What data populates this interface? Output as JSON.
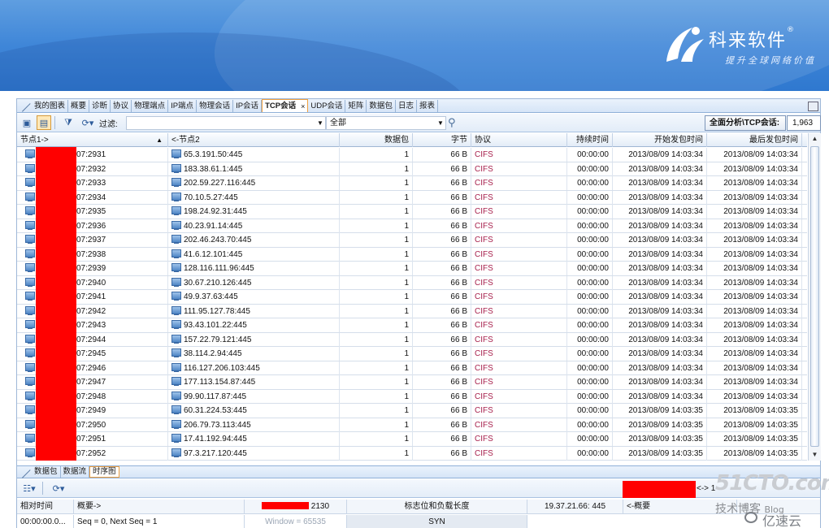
{
  "brand": {
    "name": "科来软件",
    "reg": "®",
    "slogan": "提升全球网络价值"
  },
  "top_tabs": [
    {
      "label": "我的图表",
      "active": false
    },
    {
      "label": "概要",
      "active": false
    },
    {
      "label": "诊断",
      "active": false
    },
    {
      "label": "协议",
      "active": false
    },
    {
      "label": "物理端点",
      "active": false
    },
    {
      "label": "IP端点",
      "active": false
    },
    {
      "label": "物理会话",
      "active": false
    },
    {
      "label": "IP会话",
      "active": false
    },
    {
      "label": "TCP会话",
      "active": true,
      "close": "×"
    },
    {
      "label": "UDP会话",
      "active": false
    },
    {
      "label": "矩阵",
      "active": false
    },
    {
      "label": "数据包",
      "active": false
    },
    {
      "label": "日志",
      "active": false
    },
    {
      "label": "报表",
      "active": false
    }
  ],
  "toolbar": {
    "filter_label": "过滤:",
    "scope_value": "全部",
    "summary_label": "全面分析\\TCP会话:",
    "summary_count": "1,963"
  },
  "table": {
    "columns": [
      "节点1->",
      "<-节点2",
      "数据包",
      "字节",
      "协议",
      "持续时间",
      "开始发包时间",
      "最后发包时间"
    ],
    "rows": [
      {
        "node1": "07:2931",
        "node2": "65.3.191.50:445",
        "packets": "1",
        "bytes": "66 B",
        "protocol": "CIFS",
        "duration": "00:00:00",
        "start": "2013/08/09 14:03:34",
        "last": "2013/08/09 14:03:34"
      },
      {
        "node1": "07:2932",
        "node2": "183.38.61.1:445",
        "packets": "1",
        "bytes": "66 B",
        "protocol": "CIFS",
        "duration": "00:00:00",
        "start": "2013/08/09 14:03:34",
        "last": "2013/08/09 14:03:34"
      },
      {
        "node1": "07:2933",
        "node2": "202.59.227.116:445",
        "packets": "1",
        "bytes": "66 B",
        "protocol": "CIFS",
        "duration": "00:00:00",
        "start": "2013/08/09 14:03:34",
        "last": "2013/08/09 14:03:34"
      },
      {
        "node1": "07:2934",
        "node2": "70.10.5.27:445",
        "packets": "1",
        "bytes": "66 B",
        "protocol": "CIFS",
        "duration": "00:00:00",
        "start": "2013/08/09 14:03:34",
        "last": "2013/08/09 14:03:34"
      },
      {
        "node1": "07:2935",
        "node2": "198.24.92.31:445",
        "packets": "1",
        "bytes": "66 B",
        "protocol": "CIFS",
        "duration": "00:00:00",
        "start": "2013/08/09 14:03:34",
        "last": "2013/08/09 14:03:34"
      },
      {
        "node1": "07:2936",
        "node2": "40.23.91.14:445",
        "packets": "1",
        "bytes": "66 B",
        "protocol": "CIFS",
        "duration": "00:00:00",
        "start": "2013/08/09 14:03:34",
        "last": "2013/08/09 14:03:34"
      },
      {
        "node1": "07:2937",
        "node2": "202.46.243.70:445",
        "packets": "1",
        "bytes": "66 B",
        "protocol": "CIFS",
        "duration": "00:00:00",
        "start": "2013/08/09 14:03:34",
        "last": "2013/08/09 14:03:34"
      },
      {
        "node1": "07:2938",
        "node2": "41.6.12.101:445",
        "packets": "1",
        "bytes": "66 B",
        "protocol": "CIFS",
        "duration": "00:00:00",
        "start": "2013/08/09 14:03:34",
        "last": "2013/08/09 14:03:34"
      },
      {
        "node1": "07:2939",
        "node2": "128.116.111.96:445",
        "packets": "1",
        "bytes": "66 B",
        "protocol": "CIFS",
        "duration": "00:00:00",
        "start": "2013/08/09 14:03:34",
        "last": "2013/08/09 14:03:34"
      },
      {
        "node1": "07:2940",
        "node2": "30.67.210.126:445",
        "packets": "1",
        "bytes": "66 B",
        "protocol": "CIFS",
        "duration": "00:00:00",
        "start": "2013/08/09 14:03:34",
        "last": "2013/08/09 14:03:34"
      },
      {
        "node1": "07:2941",
        "node2": "49.9.37.63:445",
        "packets": "1",
        "bytes": "66 B",
        "protocol": "CIFS",
        "duration": "00:00:00",
        "start": "2013/08/09 14:03:34",
        "last": "2013/08/09 14:03:34"
      },
      {
        "node1": "07:2942",
        "node2": "111.95.127.78:445",
        "packets": "1",
        "bytes": "66 B",
        "protocol": "CIFS",
        "duration": "00:00:00",
        "start": "2013/08/09 14:03:34",
        "last": "2013/08/09 14:03:34"
      },
      {
        "node1": "07:2943",
        "node2": "93.43.101.22:445",
        "packets": "1",
        "bytes": "66 B",
        "protocol": "CIFS",
        "duration": "00:00:00",
        "start": "2013/08/09 14:03:34",
        "last": "2013/08/09 14:03:34"
      },
      {
        "node1": "07:2944",
        "node2": "157.22.79.121:445",
        "packets": "1",
        "bytes": "66 B",
        "protocol": "CIFS",
        "duration": "00:00:00",
        "start": "2013/08/09 14:03:34",
        "last": "2013/08/09 14:03:34"
      },
      {
        "node1": "07:2945",
        "node2": "38.114.2.94:445",
        "packets": "1",
        "bytes": "66 B",
        "protocol": "CIFS",
        "duration": "00:00:00",
        "start": "2013/08/09 14:03:34",
        "last": "2013/08/09 14:03:34"
      },
      {
        "node1": "07:2946",
        "node2": "116.127.206.103:445",
        "packets": "1",
        "bytes": "66 B",
        "protocol": "CIFS",
        "duration": "00:00:00",
        "start": "2013/08/09 14:03:34",
        "last": "2013/08/09 14:03:34"
      },
      {
        "node1": "07:2947",
        "node2": "177.113.154.87:445",
        "packets": "1",
        "bytes": "66 B",
        "protocol": "CIFS",
        "duration": "00:00:00",
        "start": "2013/08/09 14:03:34",
        "last": "2013/08/09 14:03:34"
      },
      {
        "node1": "07:2948",
        "node2": "99.90.117.87:445",
        "packets": "1",
        "bytes": "66 B",
        "protocol": "CIFS",
        "duration": "00:00:00",
        "start": "2013/08/09 14:03:34",
        "last": "2013/08/09 14:03:34"
      },
      {
        "node1": "07:2949",
        "node2": "60.31.224.53:445",
        "packets": "1",
        "bytes": "66 B",
        "protocol": "CIFS",
        "duration": "00:00:00",
        "start": "2013/08/09 14:03:35",
        "last": "2013/08/09 14:03:35"
      },
      {
        "node1": "07:2950",
        "node2": "206.79.73.113:445",
        "packets": "1",
        "bytes": "66 B",
        "protocol": "CIFS",
        "duration": "00:00:00",
        "start": "2013/08/09 14:03:35",
        "last": "2013/08/09 14:03:35"
      },
      {
        "node1": "07:2951",
        "node2": "17.41.192.94:445",
        "packets": "1",
        "bytes": "66 B",
        "protocol": "CIFS",
        "duration": "00:00:00",
        "start": "2013/08/09 14:03:35",
        "last": "2013/08/09 14:03:35"
      },
      {
        "node1": "07:2952",
        "node2": "97.3.217.120:445",
        "packets": "1",
        "bytes": "66 B",
        "protocol": "CIFS",
        "duration": "00:00:00",
        "start": "2013/08/09 14:03:35",
        "last": "2013/08/09 14:03:35"
      }
    ]
  },
  "lower_tabs": [
    {
      "label": "数据包",
      "active": false
    },
    {
      "label": "数据流",
      "active": false
    },
    {
      "label": "时序图",
      "active": true
    }
  ],
  "lower_toolbar": {
    "nav_text": "<-> 1"
  },
  "timing": {
    "headers": {
      "rel_time": "相对时间",
      "summary": "概要->",
      "port": "2130",
      "flags": "标志位和负载长度",
      "peer": "19.37.21.66: 445",
      "back_summary": "<-概要"
    },
    "row": {
      "rel_time": "00:00:00.0...",
      "summary": "Seq = 0, Next Seq = 1",
      "window": "Window = 65535",
      "flag": "SYN"
    }
  },
  "watermark": {
    "site": "51CTO.com",
    "blog": "技术博客",
    "blog_tail": "Blog",
    "yisu": "亿速云"
  },
  "colors": {
    "redaction": "#ff0000",
    "protocol_text": "#a8224e",
    "banner_blue": "#3f86d8"
  }
}
